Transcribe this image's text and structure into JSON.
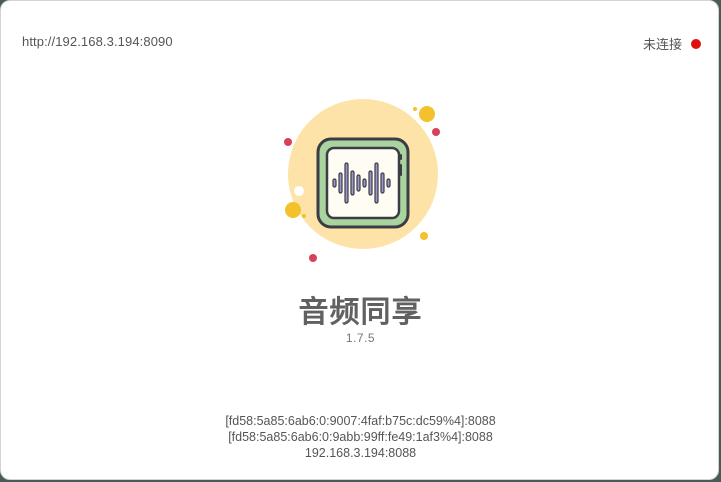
{
  "header": {
    "server_url": "http://192.168.3.194:8090",
    "connection_status": "未连接",
    "status_color": "#e01010"
  },
  "app": {
    "logo_icon": "audio-waveform-icon",
    "name": "音频同享",
    "version": "1.7.5"
  },
  "addresses": [
    "[fd58:5a85:6ab6:0:9007:4faf:b75c:dc59%4]:8088",
    "[fd58:5a85:6ab6:0:9abb:99ff:fe49:1af3%4]:8088",
    "192.168.3.194:8088"
  ],
  "colors": {
    "accent_yellow": "#f3c12c",
    "accent_red": "#d94256",
    "logo_circle": "#fde3a7",
    "logo_frame": "#a9d49f"
  }
}
